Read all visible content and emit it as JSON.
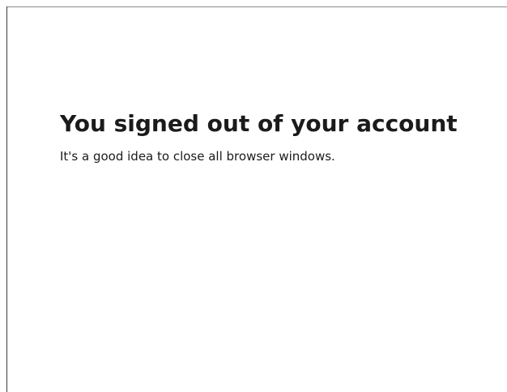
{
  "signout": {
    "title": "You signed out of your account",
    "message": "It's a good idea to close all browser windows."
  },
  "colors": {
    "background": "#ffffff",
    "text": "#1b1b1b",
    "frame_border": "#3a3a3a"
  }
}
